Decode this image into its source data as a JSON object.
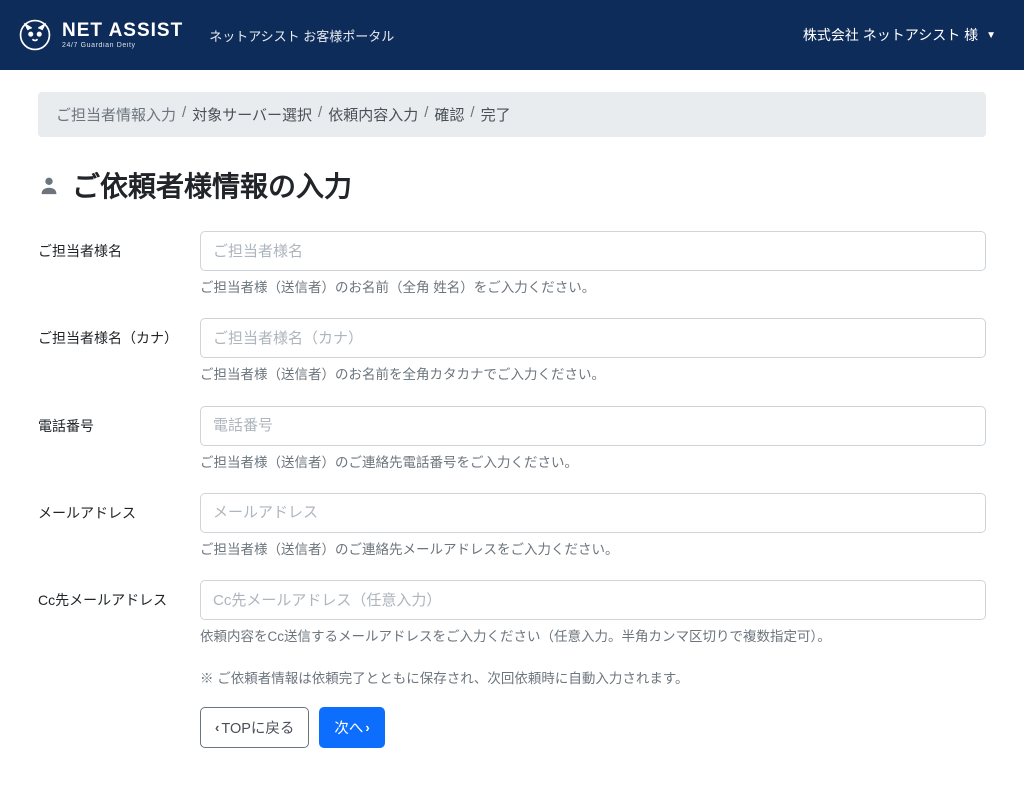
{
  "header": {
    "logo_main": "NET ASSIST",
    "logo_sub": "24/7 Guardian Deity",
    "subtitle": "ネットアシスト お客様ポータル",
    "user_label": "株式会社 ネットアシスト 様"
  },
  "breadcrumb": {
    "items": [
      {
        "label": "ご担当者情報入力",
        "active": true
      },
      {
        "label": "対象サーバー選択",
        "active": false
      },
      {
        "label": "依頼内容入力",
        "active": false
      },
      {
        "label": "確認",
        "active": false
      },
      {
        "label": "完了",
        "active": false
      }
    ]
  },
  "page": {
    "title": "ご依頼者様情報の入力"
  },
  "form": {
    "fields": {
      "name": {
        "label": "ご担当者様名",
        "placeholder": "ご担当者様名",
        "help": "ご担当者様（送信者）のお名前（全角 姓名）をご入力ください。"
      },
      "name_kana": {
        "label": "ご担当者様名（カナ）",
        "placeholder": "ご担当者様名（カナ）",
        "help": "ご担当者様（送信者）のお名前を全角カタカナでご入力ください。"
      },
      "phone": {
        "label": "電話番号",
        "placeholder": "電話番号",
        "help": "ご担当者様（送信者）のご連絡先電話番号をご入力ください。"
      },
      "email": {
        "label": "メールアドレス",
        "placeholder": "メールアドレス",
        "help": "ご担当者様（送信者）のご連絡先メールアドレスをご入力ください。"
      },
      "cc": {
        "label": "Cc先メールアドレス",
        "placeholder": "Cc先メールアドレス（任意入力）",
        "help": "依頼内容をCc送信するメールアドレスをご入力ください（任意入力。半角カンマ区切りで複数指定可）。"
      }
    },
    "note": "※ ご依頼者情報は依頼完了とともに保存され、次回依頼時に自動入力されます。",
    "buttons": {
      "back": "TOPに戻る",
      "next": "次へ"
    }
  }
}
